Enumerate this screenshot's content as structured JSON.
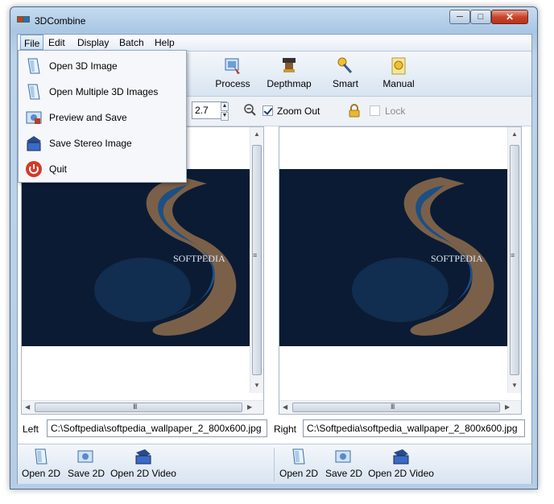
{
  "window": {
    "title": "3DCombine"
  },
  "menubar": {
    "items": [
      "File",
      "Edit",
      "Display",
      "Batch",
      "Help"
    ]
  },
  "toolbar": {
    "buttons": [
      "Process",
      "Depthmap",
      "Smart",
      "Manual"
    ]
  },
  "zoom": {
    "value": "2.7",
    "zoom_out_label": "Zoom Out",
    "zoom_out_checked": true,
    "lock_label": "Lock",
    "lock_checked": false,
    "lock_enabled": false
  },
  "file_menu": {
    "items": [
      "Open 3D Image",
      "Open Multiple 3D Images",
      "Preview and Save",
      "Save Stereo Image",
      "Quit"
    ]
  },
  "left_pane": {
    "label": "Left",
    "path": "C:\\Softpedia\\softpedia_wallpaper_2_800x600.jpg",
    "image_text": "SOFTPEDIA"
  },
  "right_pane": {
    "label": "Right",
    "path": "C:\\Softpedia\\softpedia_wallpaper_2_800x600.jpg",
    "image_text": "SOFTPEDIA"
  },
  "bottom_left": {
    "buttons": [
      "Open 2D",
      "Save 2D",
      "Open 2D Video"
    ]
  },
  "bottom_right": {
    "buttons": [
      "Open 2D",
      "Save 2D",
      "Open 2D Video"
    ]
  },
  "scrollbar_grip": "III",
  "window_controls": {
    "minimize": "─",
    "maximize": "□",
    "close": "✕"
  },
  "colors": {
    "accent": "#1b3b70",
    "close_button": "#c9442a",
    "image_bg": "#0b1b33"
  }
}
